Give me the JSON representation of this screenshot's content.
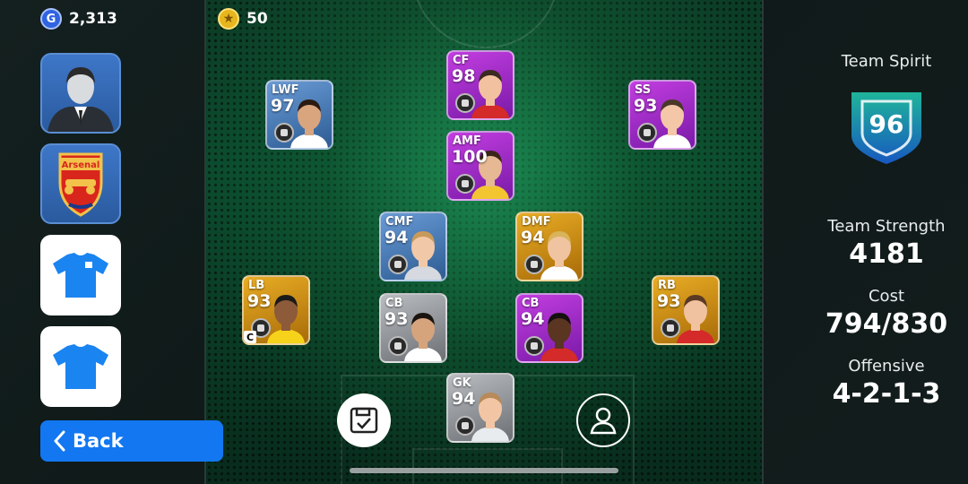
{
  "currency": {
    "gp": {
      "icon": "gp-coin-icon",
      "letter": "G",
      "value": "2,313"
    },
    "coins": {
      "icon": "star-coin-icon",
      "value": "50"
    }
  },
  "left_menu": {
    "manager_icon": "manager-avatar-icon",
    "club_badge_text": "Arsenal",
    "home_kit_icon": "home-kit-icon",
    "away_kit_icon": "away-kit-icon",
    "back_label": "Back"
  },
  "players": [
    {
      "pos": "CF",
      "rating": "98",
      "color": "purple",
      "skin": "#f2c2a0",
      "hair": "#3a2a20",
      "shirt": "#d42a2a"
    },
    {
      "pos": "LWF",
      "rating": "97",
      "color": "blue",
      "skin": "#d9a57e",
      "hair": "#2a1a12",
      "shirt": "#ffffff"
    },
    {
      "pos": "SS",
      "rating": "93",
      "color": "purple",
      "skin": "#f4c7a8",
      "hair": "#4a3828",
      "shirt": "#ffffff"
    },
    {
      "pos": "AMF",
      "rating": "100",
      "color": "purple",
      "skin": "#e6b894",
      "hair": "#3a2518",
      "shirt": "#f3c531"
    },
    {
      "pos": "CMF",
      "rating": "94",
      "color": "blue",
      "skin": "#f2c9a8",
      "hair": "#c89a5a",
      "shirt": "#d6dae0"
    },
    {
      "pos": "DMF",
      "rating": "94",
      "color": "gold",
      "skin": "#f0c4a0",
      "hair": "#d9b35a",
      "shirt": "#ffffff"
    },
    {
      "pos": "LB",
      "rating": "93",
      "color": "gold",
      "skin": "#8d5a3a",
      "hair": "#1a1a1a",
      "shirt": "#f6d31a",
      "badge": "C"
    },
    {
      "pos": "CB",
      "rating": "93",
      "color": "silver",
      "skin": "#d6a47c",
      "hair": "#1a1410",
      "shirt": "#ffffff"
    },
    {
      "pos": "CB",
      "rating": "94",
      "color": "purple",
      "skin": "#5a3522",
      "hair": "#141010",
      "shirt": "#d42a2a"
    },
    {
      "pos": "RB",
      "rating": "93",
      "color": "gold",
      "skin": "#f0c2a0",
      "hair": "#5a3a24",
      "shirt": "#d42a2a"
    },
    {
      "pos": "GK",
      "rating": "94",
      "color": "silver",
      "skin": "#f2c6a4",
      "hair": "#b88a5a",
      "shirt": "#e8ecef"
    }
  ],
  "actions": {
    "save_icon": "save-formation-icon",
    "profile_icon": "person-icon"
  },
  "team": {
    "spirit_label": "Team Spirit",
    "spirit_value": "96",
    "strength_label": "Team Strength",
    "strength_value": "4181",
    "cost_label": "Cost",
    "cost_value": "794/830",
    "tactic_label": "Offensive",
    "formation": "4-2-1-3"
  },
  "colors": {
    "back_button": "#1277f1",
    "card_blue": "#3f76b8",
    "card_purple": "#a12ccc",
    "card_gold": "#d28e12",
    "card_silver": "#8e9297",
    "shield": "#1a9a8a"
  }
}
